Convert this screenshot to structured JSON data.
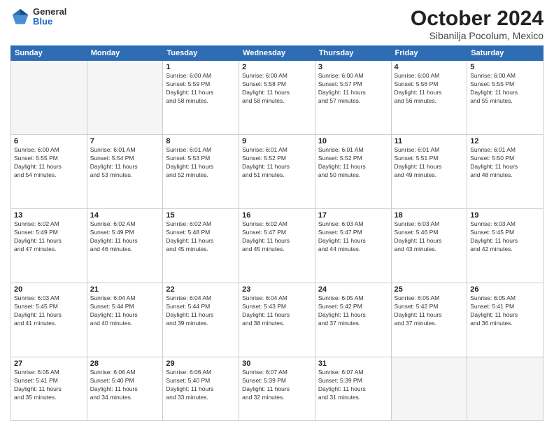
{
  "logo": {
    "general": "General",
    "blue": "Blue"
  },
  "header": {
    "month": "October 2024",
    "location": "Sibanilja Pocolum, Mexico"
  },
  "days_of_week": [
    "Sunday",
    "Monday",
    "Tuesday",
    "Wednesday",
    "Thursday",
    "Friday",
    "Saturday"
  ],
  "weeks": [
    [
      {
        "day": "",
        "info": ""
      },
      {
        "day": "",
        "info": ""
      },
      {
        "day": "1",
        "info": "Sunrise: 6:00 AM\nSunset: 5:59 PM\nDaylight: 11 hours\nand 58 minutes."
      },
      {
        "day": "2",
        "info": "Sunrise: 6:00 AM\nSunset: 5:58 PM\nDaylight: 11 hours\nand 58 minutes."
      },
      {
        "day": "3",
        "info": "Sunrise: 6:00 AM\nSunset: 5:57 PM\nDaylight: 11 hours\nand 57 minutes."
      },
      {
        "day": "4",
        "info": "Sunrise: 6:00 AM\nSunset: 5:56 PM\nDaylight: 11 hours\nand 56 minutes."
      },
      {
        "day": "5",
        "info": "Sunrise: 6:00 AM\nSunset: 5:55 PM\nDaylight: 11 hours\nand 55 minutes."
      }
    ],
    [
      {
        "day": "6",
        "info": "Sunrise: 6:00 AM\nSunset: 5:55 PM\nDaylight: 11 hours\nand 54 minutes."
      },
      {
        "day": "7",
        "info": "Sunrise: 6:01 AM\nSunset: 5:54 PM\nDaylight: 11 hours\nand 53 minutes."
      },
      {
        "day": "8",
        "info": "Sunrise: 6:01 AM\nSunset: 5:53 PM\nDaylight: 11 hours\nand 52 minutes."
      },
      {
        "day": "9",
        "info": "Sunrise: 6:01 AM\nSunset: 5:52 PM\nDaylight: 11 hours\nand 51 minutes."
      },
      {
        "day": "10",
        "info": "Sunrise: 6:01 AM\nSunset: 5:52 PM\nDaylight: 11 hours\nand 50 minutes."
      },
      {
        "day": "11",
        "info": "Sunrise: 6:01 AM\nSunset: 5:51 PM\nDaylight: 11 hours\nand 49 minutes."
      },
      {
        "day": "12",
        "info": "Sunrise: 6:01 AM\nSunset: 5:50 PM\nDaylight: 11 hours\nand 48 minutes."
      }
    ],
    [
      {
        "day": "13",
        "info": "Sunrise: 6:02 AM\nSunset: 5:49 PM\nDaylight: 11 hours\nand 47 minutes."
      },
      {
        "day": "14",
        "info": "Sunrise: 6:02 AM\nSunset: 5:49 PM\nDaylight: 11 hours\nand 46 minutes."
      },
      {
        "day": "15",
        "info": "Sunrise: 6:02 AM\nSunset: 5:48 PM\nDaylight: 11 hours\nand 45 minutes."
      },
      {
        "day": "16",
        "info": "Sunrise: 6:02 AM\nSunset: 5:47 PM\nDaylight: 11 hours\nand 45 minutes."
      },
      {
        "day": "17",
        "info": "Sunrise: 6:03 AM\nSunset: 5:47 PM\nDaylight: 11 hours\nand 44 minutes."
      },
      {
        "day": "18",
        "info": "Sunrise: 6:03 AM\nSunset: 5:46 PM\nDaylight: 11 hours\nand 43 minutes."
      },
      {
        "day": "19",
        "info": "Sunrise: 6:03 AM\nSunset: 5:45 PM\nDaylight: 11 hours\nand 42 minutes."
      }
    ],
    [
      {
        "day": "20",
        "info": "Sunrise: 6:03 AM\nSunset: 5:45 PM\nDaylight: 11 hours\nand 41 minutes."
      },
      {
        "day": "21",
        "info": "Sunrise: 6:04 AM\nSunset: 5:44 PM\nDaylight: 11 hours\nand 40 minutes."
      },
      {
        "day": "22",
        "info": "Sunrise: 6:04 AM\nSunset: 5:44 PM\nDaylight: 11 hours\nand 39 minutes."
      },
      {
        "day": "23",
        "info": "Sunrise: 6:04 AM\nSunset: 5:43 PM\nDaylight: 11 hours\nand 38 minutes."
      },
      {
        "day": "24",
        "info": "Sunrise: 6:05 AM\nSunset: 5:42 PM\nDaylight: 11 hours\nand 37 minutes."
      },
      {
        "day": "25",
        "info": "Sunrise: 6:05 AM\nSunset: 5:42 PM\nDaylight: 11 hours\nand 37 minutes."
      },
      {
        "day": "26",
        "info": "Sunrise: 6:05 AM\nSunset: 5:41 PM\nDaylight: 11 hours\nand 36 minutes."
      }
    ],
    [
      {
        "day": "27",
        "info": "Sunrise: 6:05 AM\nSunset: 5:41 PM\nDaylight: 11 hours\nand 35 minutes."
      },
      {
        "day": "28",
        "info": "Sunrise: 6:06 AM\nSunset: 5:40 PM\nDaylight: 11 hours\nand 34 minutes."
      },
      {
        "day": "29",
        "info": "Sunrise: 6:06 AM\nSunset: 5:40 PM\nDaylight: 11 hours\nand 33 minutes."
      },
      {
        "day": "30",
        "info": "Sunrise: 6:07 AM\nSunset: 5:39 PM\nDaylight: 11 hours\nand 32 minutes."
      },
      {
        "day": "31",
        "info": "Sunrise: 6:07 AM\nSunset: 5:39 PM\nDaylight: 11 hours\nand 31 minutes."
      },
      {
        "day": "",
        "info": ""
      },
      {
        "day": "",
        "info": ""
      }
    ]
  ]
}
